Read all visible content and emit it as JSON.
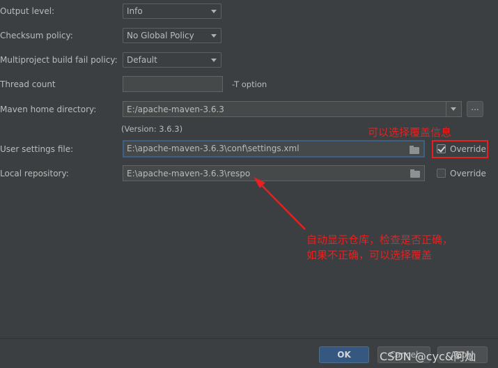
{
  "form": {
    "output_level": {
      "label": "Output level:",
      "value": "Info"
    },
    "checksum_policy": {
      "label": "Checksum policy:",
      "value": "No Global Policy"
    },
    "multiproject": {
      "label": "Multiproject build fail policy:",
      "value": "Default"
    },
    "thread_count": {
      "label": "Thread count",
      "value": "",
      "hint": "-T option"
    },
    "maven_home": {
      "label": "Maven home directory:",
      "value": "E:/apache-maven-3.6.3",
      "browse": "...",
      "version": "(Version: 3.6.3)"
    },
    "user_settings": {
      "label": "User settings file:",
      "value": "E:\\apache-maven-3.6.3\\conf\\settings.xml",
      "override_label": "Override",
      "override_checked": true
    },
    "local_repo": {
      "label": "Local repository:",
      "value": "E:\\apache-maven-3.6.3\\respo",
      "override_label": "Override",
      "override_checked": false
    }
  },
  "annotations": {
    "top_note": "可以选择覆盖信息",
    "bottom_line1": "自动显示仓库，检查是否正确，",
    "bottom_line2": "如果不正确，可以选择覆盖",
    "color": "#e8201f"
  },
  "footer": {
    "ok": "OK",
    "cancel": "Cancel",
    "apply": "Apply",
    "watermark": "CSDN @cyc&阿灿"
  },
  "colors": {
    "background": "#3c3f41",
    "primary_button": "#365880",
    "focus_border": "#3d6185"
  }
}
